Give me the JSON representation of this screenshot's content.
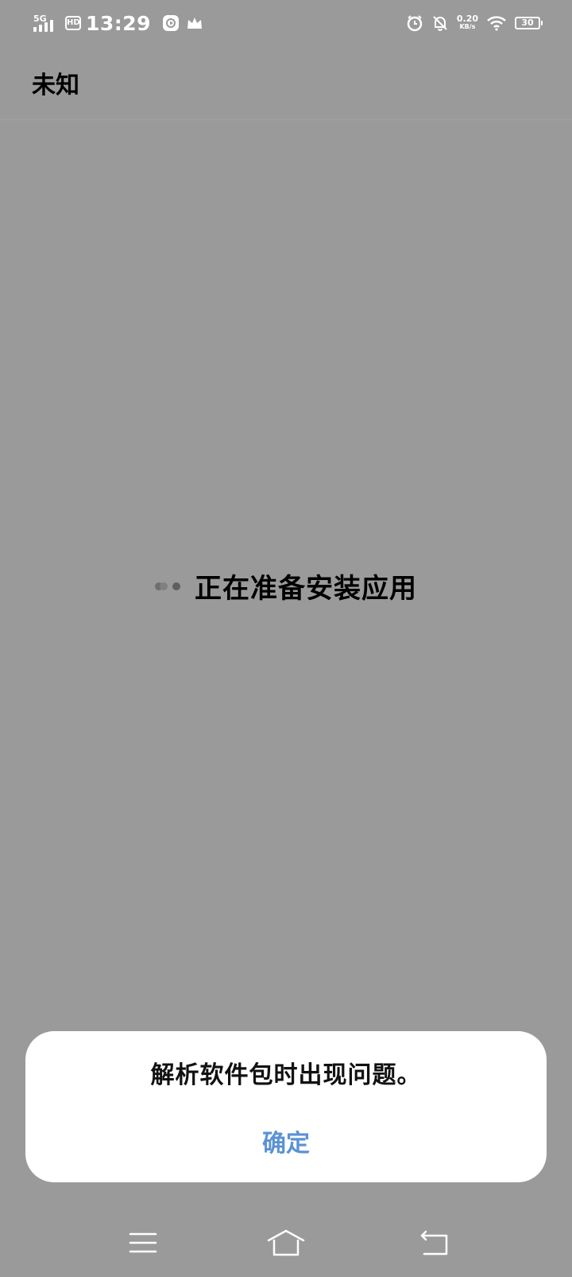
{
  "status_bar": {
    "network_type": "5G",
    "hd_label": "HD",
    "time": "13:29",
    "speed_value": "0.20",
    "speed_unit": "KB/s",
    "battery_level": "30",
    "icons": [
      "signal-icon",
      "hd-icon",
      "app-notification-icon",
      "crown-icon",
      "alarm-icon",
      "bell-off-icon",
      "wifi-icon",
      "battery-icon"
    ]
  },
  "header": {
    "title": "未知"
  },
  "main": {
    "loading_text": "正在准备安装应用"
  },
  "dialog": {
    "message": "解析软件包时出现问题。",
    "confirm_label": "确定"
  },
  "nav_bar": {
    "buttons": [
      "menu-icon",
      "home-icon",
      "back-icon"
    ]
  },
  "colors": {
    "background": "#9a9a9a",
    "dialog_bg": "#ffffff",
    "accent": "#5b92d4",
    "text": "#000000"
  }
}
